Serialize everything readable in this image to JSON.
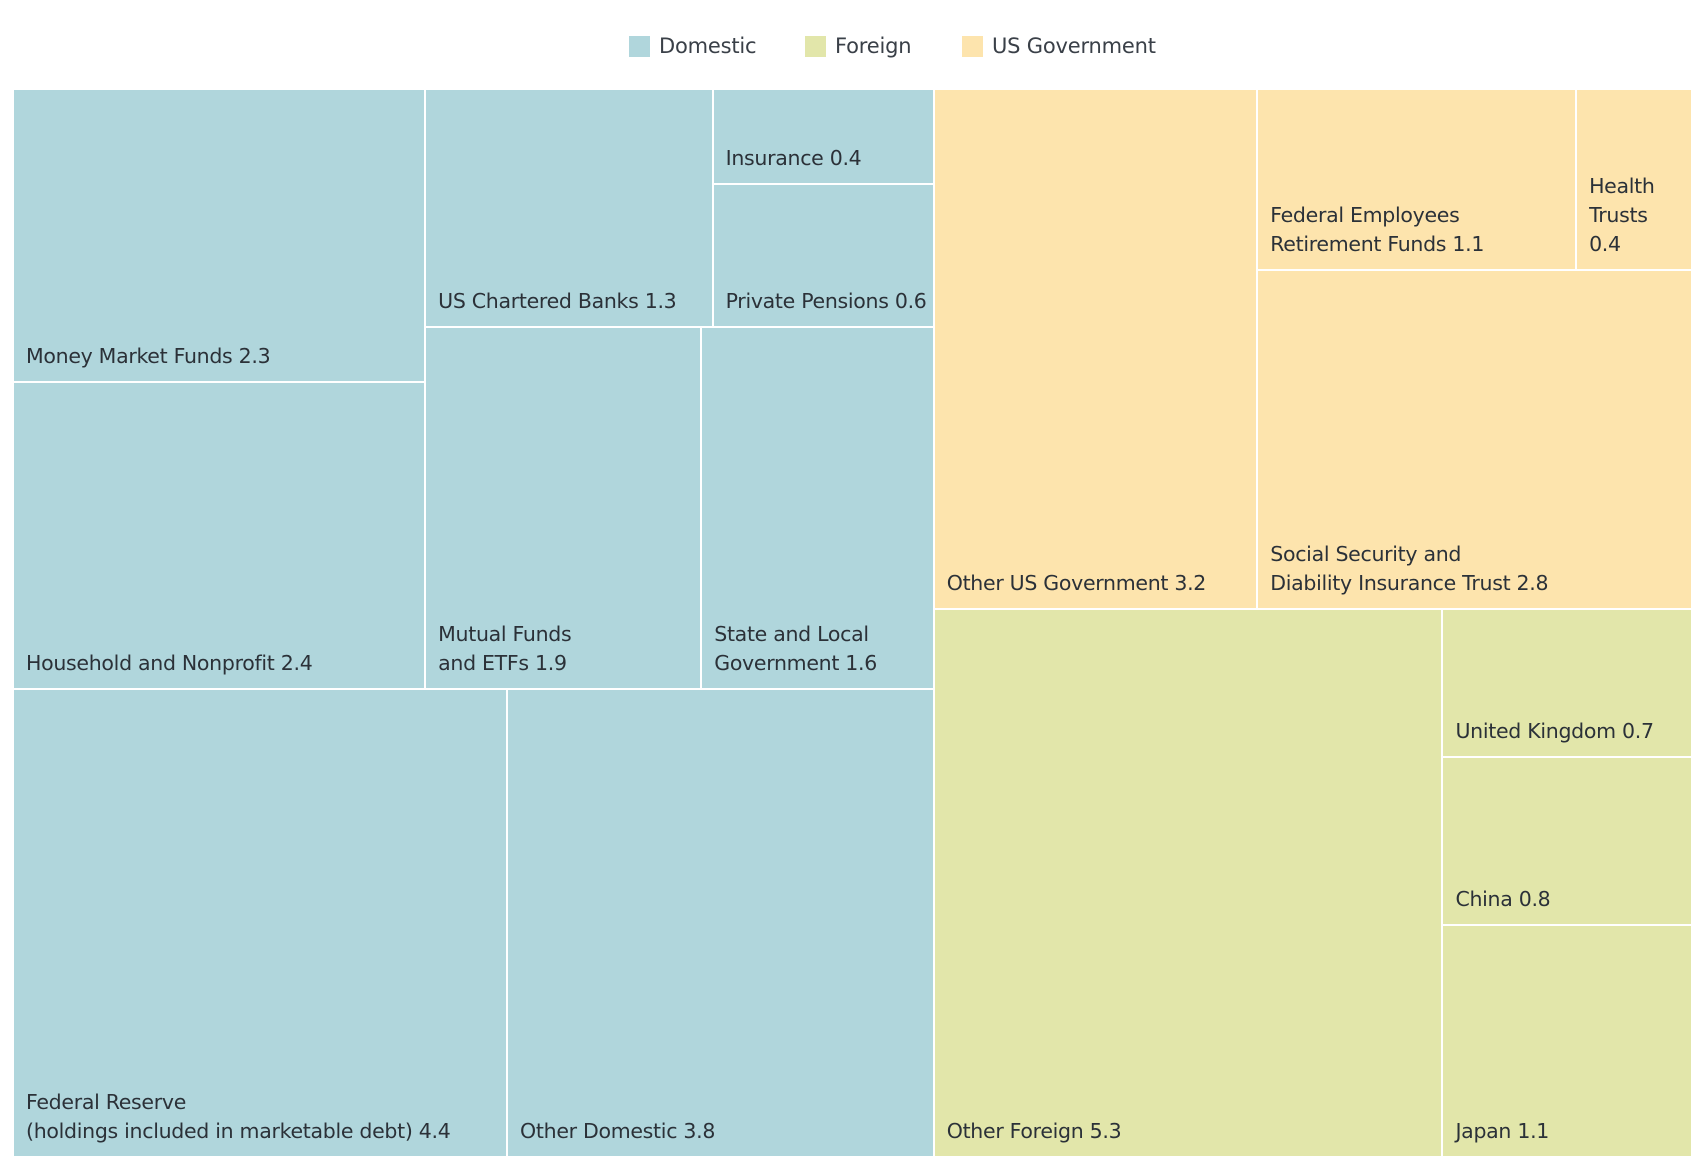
{
  "chart_data": {
    "type": "treemap",
    "title": "",
    "legend": {
      "placement": "top-center",
      "entries": [
        {
          "name": "Domestic",
          "color": "#b0d6dc"
        },
        {
          "name": "Foreign",
          "color": "#e2e6aa"
        },
        {
          "name": "US Government",
          "color": "#fde4ad"
        }
      ]
    },
    "groups": [
      {
        "name": "Domestic",
        "color": "#b0d6dc",
        "items": [
          {
            "id": "money-market-funds",
            "label": "Money Market Funds 2.3",
            "name": "Money Market Funds",
            "value": 2.3
          },
          {
            "id": "household-nonprofit",
            "label": "Household and Nonprofit 2.4",
            "name": "Household and Nonprofit",
            "value": 2.4
          },
          {
            "id": "us-chartered-banks",
            "label": "US Chartered Banks 1.3",
            "name": "US Chartered Banks",
            "value": 1.3
          },
          {
            "id": "insurance",
            "label": "Insurance 0.4",
            "name": "Insurance",
            "value": 0.4
          },
          {
            "id": "private-pensions",
            "label": "Private Pensions 0.6",
            "name": "Private Pensions",
            "value": 0.6
          },
          {
            "id": "mutual-funds-etfs",
            "label": "Mutual Funds\nand ETFs 1.9",
            "name": "Mutual Funds and ETFs",
            "value": 1.9
          },
          {
            "id": "state-local-government",
            "label": "State and Local\nGovernment 1.6",
            "name": "State and Local Government",
            "value": 1.6
          },
          {
            "id": "federal-reserve",
            "label": "Federal Reserve\n(holdings included in marketable debt) 4.4",
            "name": "Federal Reserve (holdings included in marketable debt)",
            "value": 4.4
          },
          {
            "id": "other-domestic",
            "label": "Other Domestic 3.8",
            "name": "Other Domestic",
            "value": 3.8
          }
        ]
      },
      {
        "name": "US Government",
        "color": "#fde4ad",
        "items": [
          {
            "id": "other-us-government",
            "label": "Other US Government 3.2",
            "name": "Other US Government",
            "value": 3.2
          },
          {
            "id": "federal-employees-retirement",
            "label": "Federal Employees\nRetirement Funds 1.1",
            "name": "Federal Employees Retirement Funds",
            "value": 1.1
          },
          {
            "id": "health-trusts",
            "label": "Health\nTrusts 0.4",
            "name": "Health Trusts",
            "value": 0.4
          },
          {
            "id": "social-security-disability",
            "label": "Social Security and\nDiability Insurance Trust 2.8",
            "name": "Social Security and Diability Insurance Trust",
            "value": 2.8
          }
        ]
      },
      {
        "name": "Foreign",
        "color": "#e2e6aa",
        "items": [
          {
            "id": "other-foreign",
            "label": "Other Foreign 5.3",
            "name": "Other Foreign",
            "value": 5.3
          },
          {
            "id": "united-kingdom",
            "label": "United Kingdom 0.7",
            "name": "United Kingdom",
            "value": 0.7
          },
          {
            "id": "china",
            "label": "China 0.8",
            "name": "China",
            "value": 0.8
          },
          {
            "id": "japan",
            "label": "Japan 1.1",
            "name": "Japan",
            "value": 1.1
          }
        ]
      }
    ]
  }
}
